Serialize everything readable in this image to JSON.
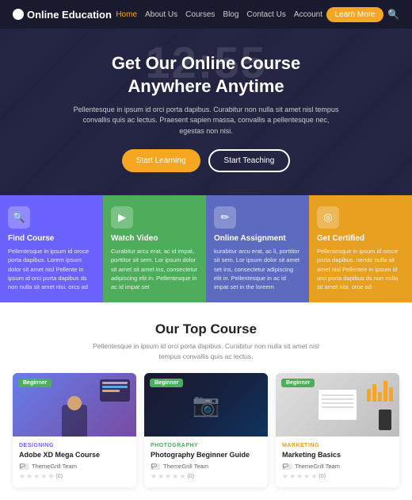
{
  "brand": {
    "logo_text": "Online Education"
  },
  "navbar": {
    "links": [
      {
        "label": "Home",
        "active": true
      },
      {
        "label": "About Us",
        "active": false
      },
      {
        "label": "Courses",
        "active": false
      },
      {
        "label": "Blog",
        "active": false
      },
      {
        "label": "Contact Us",
        "active": false
      },
      {
        "label": "Account",
        "active": false
      }
    ],
    "cta_label": "Learn More",
    "search_icon": "🔍"
  },
  "hero": {
    "clock_text": "12:55",
    "title_line1": "Get Our Online Course",
    "title_line2": "Anywhere Anytime",
    "subtitle": "Pellentesque in ipsum id orci porta dapibus. Curabitur non nulla sit amet nisl tempus convallis quis ac lectus. Praesent sapien massa, convallis a pellentesque nec, egestas non nisi.",
    "btn_learning": "Start Learning",
    "btn_teaching": "Start Teaching"
  },
  "features": [
    {
      "icon": "🔍",
      "title": "Find Course",
      "desc": "Pellentesque in ipsum id oroce porta dapibus. Lorem ipsum dolor sit amet nisl Pellente in ipsum id orci porta dapibus ds non nulla sit amet nisi. orcs ad"
    },
    {
      "icon": "▶",
      "title": "Watch Video",
      "desc": "Curabitur arcu erat, ac id impat, porttitor sit sem. Lor ipsum dolor sit amet sit amet ins, consectetur adipiscing elit in. Pellentesque in ac id impat set"
    },
    {
      "icon": "✏",
      "title": "Online Assignment",
      "desc": "kurabitur arcu erat, ac li, porttitor sit sem. Lor ipsum dolor sit amet set ins, consectetur adipiscing elit in. Pellentesque in ac id impat set in the loreem"
    },
    {
      "icon": "◎",
      "title": "Get Certified",
      "desc": "Pellentesque in ipsum id oroce porta dapibus. nendo nulla sit amet nisl Pellentee in ipsum id orci porta dapibus ds non nulla sit amet nisi. orce ad"
    }
  ],
  "courses_section": {
    "heading": "Our Top Course",
    "subtitle": "Pellentesque in ipsum id orci porta dapibus. Curabitur non nulla sit amet nisl tempus convallis quis ac lectus."
  },
  "courses": [
    {
      "badge": "Beginner",
      "category": "DESIGNING",
      "category_class": "designing",
      "name": "Adobe XD Mega Course",
      "author": "ThemeGrill Team",
      "rating": 0,
      "review_count": "(0)"
    },
    {
      "badge": "Beginner",
      "category": "PHOTOGRAPHY",
      "category_class": "photography",
      "name": "Photography Beginner Guide",
      "author": "ThemeGrill Team",
      "rating": 0,
      "review_count": "(0)"
    },
    {
      "badge": "Beginner",
      "category": "MARKETING",
      "category_class": "marketing",
      "name": "Marketing Basics",
      "author": "ThemeGrill Team",
      "rating": 0,
      "review_count": "(0)"
    }
  ]
}
